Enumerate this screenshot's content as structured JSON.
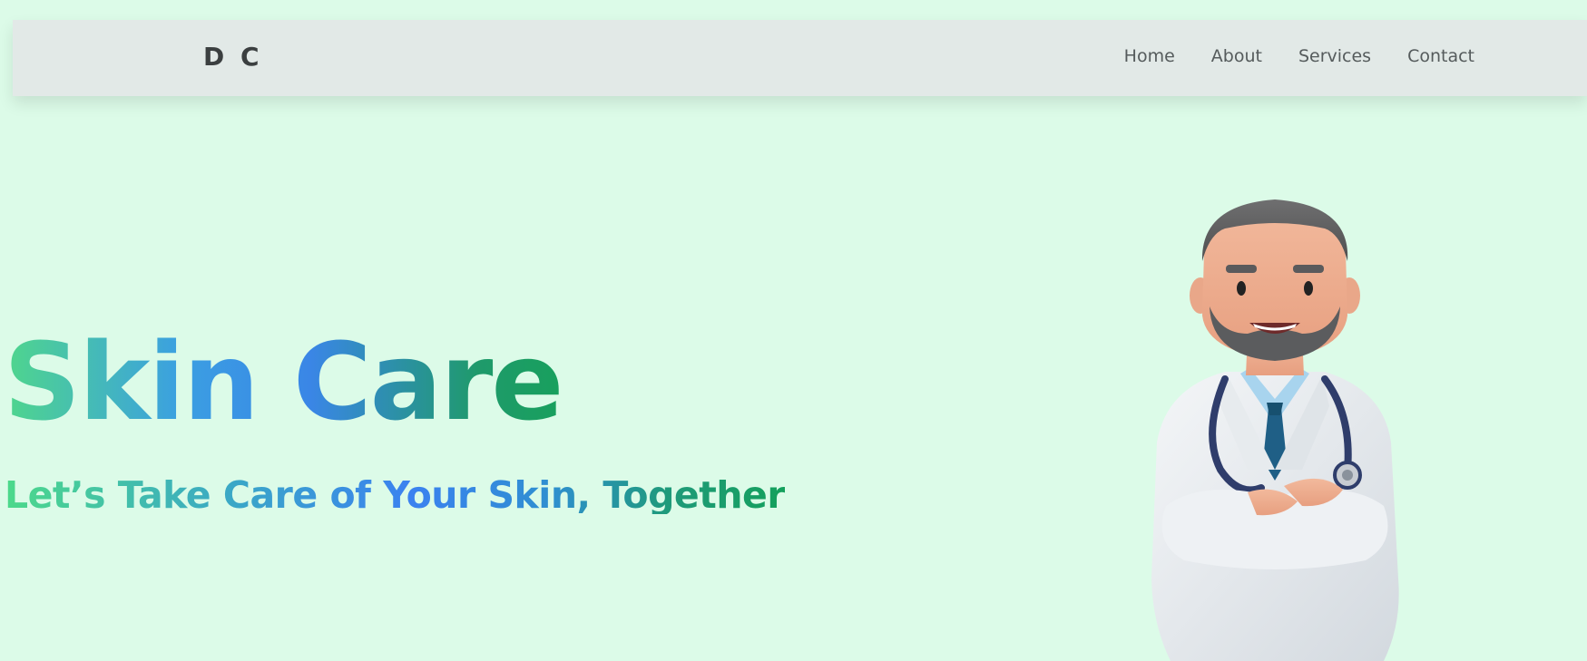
{
  "navbar": {
    "logo": "D C",
    "links": [
      {
        "label": "Home"
      },
      {
        "label": "About"
      },
      {
        "label": "Services"
      },
      {
        "label": "Contact"
      }
    ]
  },
  "hero": {
    "title": "Skin Care",
    "subtitle": "Let’s Take Care of Your Skin, Together",
    "illustration": "doctor-illustration"
  },
  "colors": {
    "background": "#dcfbe8",
    "navbar": "#e2e9e7",
    "gradient_green": "#4fd68c",
    "gradient_blue": "#3b82f0",
    "gradient_dark_green": "#18a05d"
  }
}
